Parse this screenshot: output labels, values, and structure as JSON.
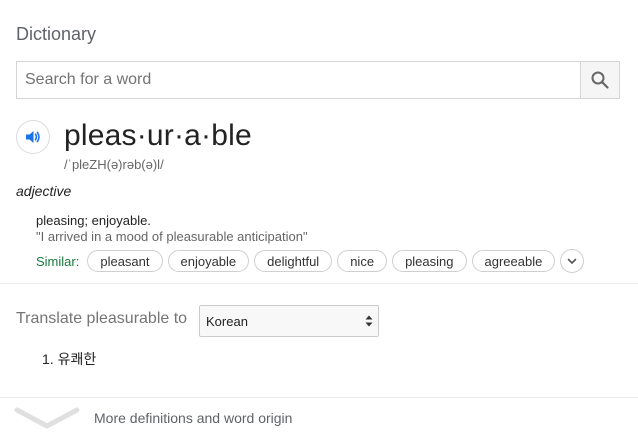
{
  "panel": {
    "title": "Dictionary"
  },
  "search": {
    "placeholder": "Search for a word",
    "value": ""
  },
  "entry": {
    "headword": "pleas·ur·a·ble",
    "phonetic": "/ˈpleZH(ə)rəb(ə)l/",
    "part_of_speech": "adjective",
    "definition": "pleasing; enjoyable.",
    "example": "\"I arrived in a mood of pleasurable anticipation\"",
    "similar_label": "Similar:",
    "similar": [
      "pleasant",
      "enjoyable",
      "delightful",
      "nice",
      "pleasing",
      "agreeable"
    ]
  },
  "translate": {
    "label": "Translate pleasurable to",
    "selected_language": "Korean",
    "results": [
      "1. 유쾌한"
    ]
  },
  "footer": {
    "more_label": "More definitions and word origin"
  },
  "colors": {
    "similar_label": "#1a7a3e",
    "speaker_icon": "#1a73e8",
    "divider": "#ebebeb"
  }
}
